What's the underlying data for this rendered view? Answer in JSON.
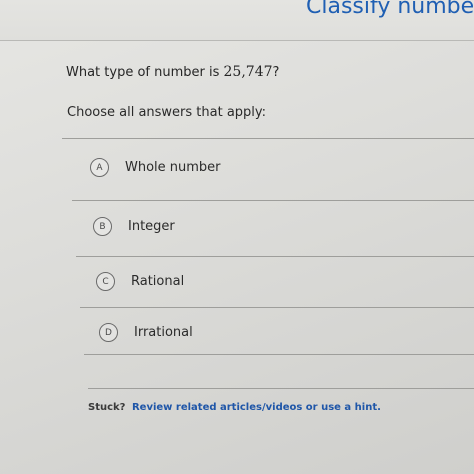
{
  "header": {
    "title": "Classify numbe"
  },
  "question": {
    "prefix": "What type of number is ",
    "number": "25,747",
    "suffix": "?"
  },
  "instruction": "Choose all answers that apply:",
  "choices": [
    {
      "letter": "A",
      "label": "Whole number"
    },
    {
      "letter": "B",
      "label": "Integer"
    },
    {
      "letter": "C",
      "label": "Rational"
    },
    {
      "letter": "D",
      "label": "Irrational"
    }
  ],
  "help": {
    "prefix": "Stuck?",
    "link": "Review related articles/videos or use a hint."
  }
}
